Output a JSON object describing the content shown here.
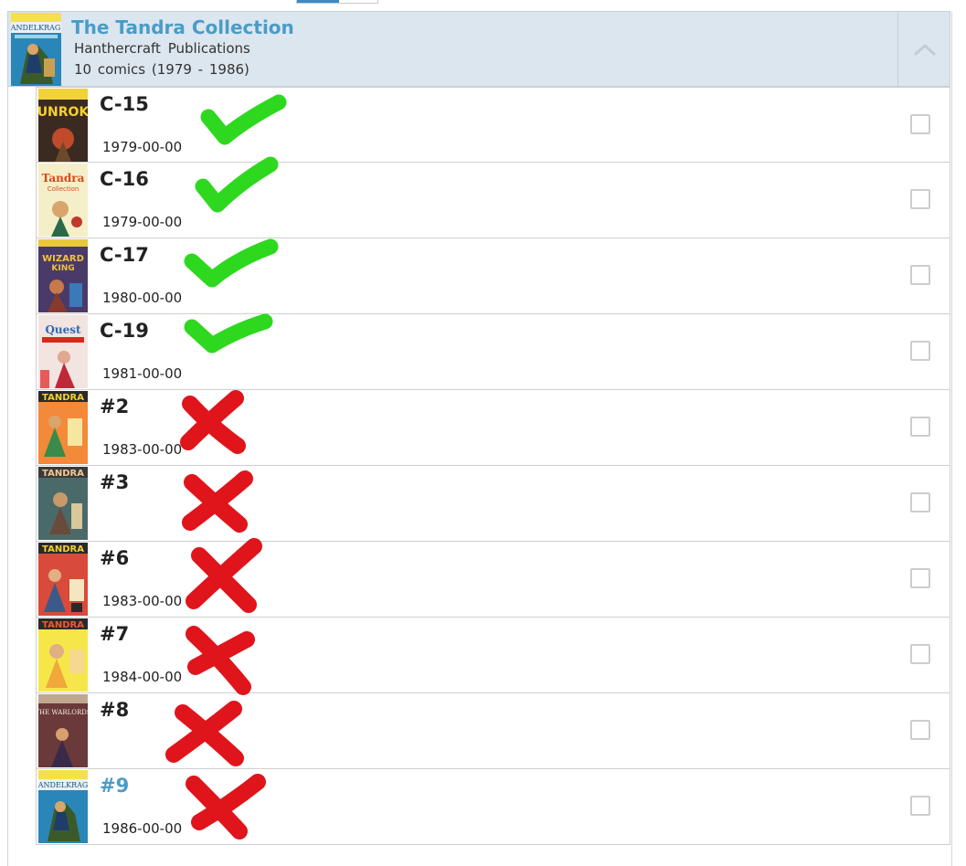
{
  "colors": {
    "header_bg": "#dce6ee",
    "title_link": "#4a9cc9",
    "check_mark": "#2ed81e",
    "cross_mark": "#e0141b"
  },
  "series": {
    "title": "The Tandra Collection",
    "publisher": "Hanthercraft  Publications",
    "count_line": "10 comics  (1979 - 1986)",
    "collapse_icon": "chevron-up-icon"
  },
  "issues": [
    {
      "number": "C-15",
      "date": "1979-00-00",
      "mark": "check"
    },
    {
      "number": "C-16",
      "date": "1979-00-00",
      "mark": "check"
    },
    {
      "number": "C-17",
      "date": "1980-00-00",
      "mark": "check"
    },
    {
      "number": "C-19",
      "date": "1981-00-00",
      "mark": "check"
    },
    {
      "number": "#2",
      "date": "1983-00-00",
      "mark": "cross"
    },
    {
      "number": "#3",
      "date": "",
      "mark": "cross"
    },
    {
      "number": "#6",
      "date": "1983-00-00",
      "mark": "cross"
    },
    {
      "number": "#7",
      "date": "1984-00-00",
      "mark": "cross"
    },
    {
      "number": "#8",
      "date": "",
      "mark": "cross"
    },
    {
      "number": "#9",
      "date": "1986-00-00",
      "mark": "cross"
    }
  ]
}
